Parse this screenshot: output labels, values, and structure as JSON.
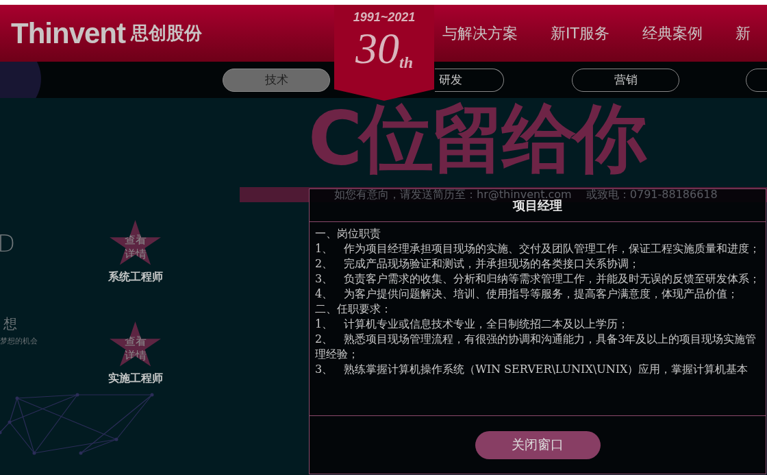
{
  "header": {
    "logo_text": "Thinvent",
    "logo_subtext": "思创股份",
    "badge": {
      "years": "1991~2021",
      "number": "30",
      "suffix": "th"
    },
    "nav": [
      {
        "label": "与解决方案"
      },
      {
        "label": "新IT服务"
      },
      {
        "label": "经典案例"
      },
      {
        "label": "新"
      }
    ]
  },
  "tabs": [
    {
      "label": "技术",
      "selected": true
    },
    {
      "label": "研发",
      "selected": false
    },
    {
      "label": "营销",
      "selected": false
    },
    {
      "selected": false
    }
  ],
  "banner": {
    "headline": "C位留给你",
    "contact": "如您有意向，请发送简历至：hr@thinvent.com　 或致电：0791-88186618"
  },
  "side_text": [
    {
      "text": "D"
    },
    {
      "text": "想"
    },
    {
      "text": "梦想的机会"
    }
  ],
  "jobs": [
    {
      "action": "查看详情",
      "title": "系统工程师"
    },
    {
      "action": "查看详情",
      "title": "实施工程师"
    }
  ],
  "modal": {
    "title": "项目经理",
    "lines": [
      "一、岗位职责",
      "1、　作为项目经理承担项目现场的实施、交付及团队管理工作，保证工程实施质量和进度；",
      "2、　完成产品现场验证和测试，并承担现场的各类接口关系协调；",
      "3、　负责客户需求的收集、分析和归纳等需求管理工作，并能及时无误的反馈至研发体系；",
      "4、　为客户提供问题解决、培训、使用指导等服务，提高客户满意度，体现产品价值；",
      "二、任职要求：",
      "1、　计算机专业或信息技术专业，全日制统招二本及以上学历；",
      "2、　熟悉项目现场管理流程，有很强的协调和沟通能力，具备3年及以上的项目现场实施管理经验；",
      "3、　熟练掌握计算机操作系统（WIN SERVER\\LUNIX\\UNIX）应用，掌握计算机基本"
    ],
    "button": "关闭窗口"
  }
}
